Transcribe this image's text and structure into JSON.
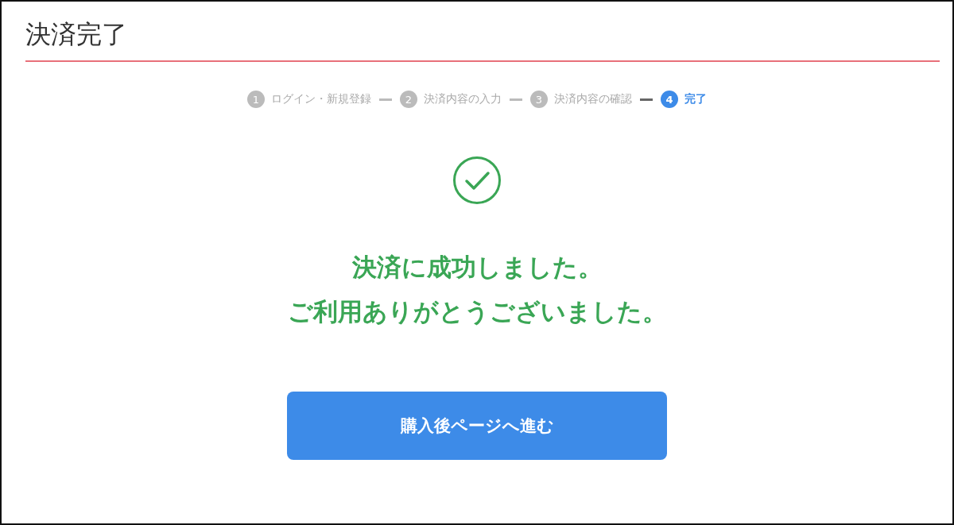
{
  "header": {
    "title": "決済完了"
  },
  "steps": [
    {
      "number": "1",
      "label": "ログイン・新規登録",
      "selected": false
    },
    {
      "number": "2",
      "label": "決済内容の入力",
      "selected": false
    },
    {
      "number": "3",
      "label": "決済内容の確認",
      "selected": false
    },
    {
      "number": "4",
      "label": "完了",
      "selected": true
    }
  ],
  "message": {
    "lines": [
      "決済に成功しました。",
      "ご利用ありがとうございました。"
    ]
  },
  "button": {
    "label": "購入後ページへ進む"
  }
}
